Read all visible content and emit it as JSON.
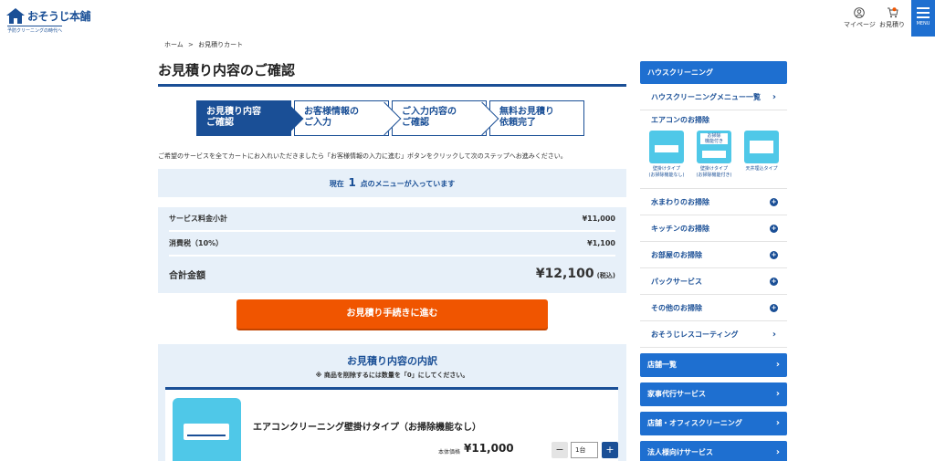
{
  "header": {
    "logo_text": "おそうじ本舗",
    "logo_tagline": "予防クリーニングの時代へ",
    "mypage_label": "マイページ",
    "estimate_label": "お見積り",
    "menu_label": "MENU"
  },
  "breadcrumb": {
    "home": "ホーム",
    "separator": ">",
    "current": "お見積りカート"
  },
  "page_title": "お見積り内容のご確認",
  "steps": [
    {
      "label": "お見積り内容\nご確認",
      "active": true
    },
    {
      "label": "お客様情報の\nご入力",
      "active": false
    },
    {
      "label": "ご入力内容の\nご確認",
      "active": false
    },
    {
      "label": "無料お見積り\n依頼完了",
      "active": false
    }
  ],
  "intro_text": "ご希望のサービスを全てカートにお入れいただきましたら「お客様情報の入力に進む」ボタンをクリックして次のステップへお進みください。",
  "notice": {
    "prefix": "現在",
    "count": "1",
    "suffix": "点のメニューが入っています"
  },
  "summary": {
    "subtotal_label": "サービス料金小計",
    "subtotal_value": "¥11,000",
    "tax_label": "消費税（10%）",
    "tax_value": "¥1,100",
    "total_label": "合計金額",
    "total_value": "¥12,100",
    "total_tax_note": "(税込)"
  },
  "proceed_label": "お見積り手続きに進む",
  "breakdown": {
    "title": "お見積り内容の内訳",
    "note": "※ 商品を削除するには数量を「0」にしてください。",
    "items": [
      {
        "name": "エアコンクリーニング壁掛けタイプ（お掃除機能なし）",
        "price_label": "本体価格",
        "price": "¥11,000",
        "qty_minus": "−",
        "qty_value": "1台",
        "qty_plus": "+"
      }
    ]
  },
  "sidebar": {
    "house_cleaning_header": "ハウスクリーニング",
    "menu_list_link": "ハウスクリーニングメニュー一覧",
    "aircon_heading": "エアコンのお掃除",
    "aircon_types": [
      {
        "label": "壁掛けタイプ\n(お掃除機能なし)",
        "tag": ""
      },
      {
        "label": "壁掛けタイプ\n(お掃除機能付き)",
        "tag": "お掃除\n機能付き"
      },
      {
        "label": "天井埋込タイプ",
        "tag": ""
      }
    ],
    "category_links": [
      {
        "label": "水まわりのお掃除",
        "icon": "plus-circle-icon"
      },
      {
        "label": "キッチンのお掃除",
        "icon": "plus-circle-icon"
      },
      {
        "label": "お部屋のお掃除",
        "icon": "plus-circle-icon"
      },
      {
        "label": "パックサービス",
        "icon": "plus-circle-icon"
      },
      {
        "label": "その他のお掃除",
        "icon": "plus-circle-icon"
      },
      {
        "label": "おそうじレスコーティング",
        "icon": "chevron-right-icon"
      }
    ],
    "blue_links": [
      {
        "label": "店舗一覧"
      },
      {
        "label": "家事代行サービス"
      },
      {
        "label": "店舗・オフィスクリーニング"
      },
      {
        "label": "法人様向けサービス"
      }
    ]
  },
  "colors": {
    "brand_blue": "#1a4f96",
    "accent_blue": "#1e6fd0",
    "cta_orange": "#f05500",
    "panel_bg": "#e7f0f9",
    "aircon_cyan": "#4fc8e8"
  }
}
